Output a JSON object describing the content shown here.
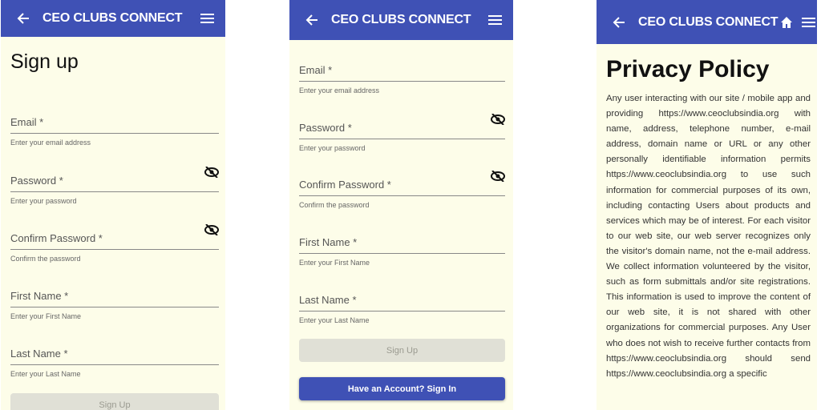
{
  "app": {
    "title": "CEO CLUBS CONNECT"
  },
  "signup": {
    "heading": "Sign up",
    "email": {
      "label": "Email *",
      "hint": "Enter your email address"
    },
    "password": {
      "label": "Password *",
      "hint": "Enter your password"
    },
    "confirm": {
      "label": "Confirm Password *",
      "hint": "Confirm the password"
    },
    "first_name": {
      "label": "First Name *",
      "hint": "Enter your First Name"
    },
    "last_name": {
      "label": "Last Name *",
      "hint": "Enter your Last Name"
    },
    "submit_label": "Sign Up",
    "signin_label": "Have an Account? Sign In"
  },
  "privacy": {
    "heading": "Privacy Policy",
    "body": "Any user interacting with our site / mobile app and providing https://www.ceoclubsindia.org with name, address, telephone number, e-mail address, domain name or URL or any other personally identifiable information permits https://www.ceoclubsindia.org to use such information for commercial purposes of its own, including contacting Users about products and services which may be of interest. For each visitor to our web site, our web server recognizes only the visitor's domain name, not the e-mail address. We collect information volunteered by the visitor, such as form submittals and/or site registrations. This information is used to improve the content of our web site, it is not shared with other organizations for commercial purposes. Any User who does not wish to receive further contacts from https://www.ceoclubsindia.org should send https://www.ceoclubsindia.org a specific"
  },
  "icons": {
    "back": "arrow-left-icon",
    "menu": "hamburger-menu-icon",
    "home": "home-icon",
    "visibility": "eye-off-icon"
  },
  "colors": {
    "primary": "#3f51b5",
    "background": "#fdfde9",
    "disabled_button": "#e0e0d6"
  }
}
